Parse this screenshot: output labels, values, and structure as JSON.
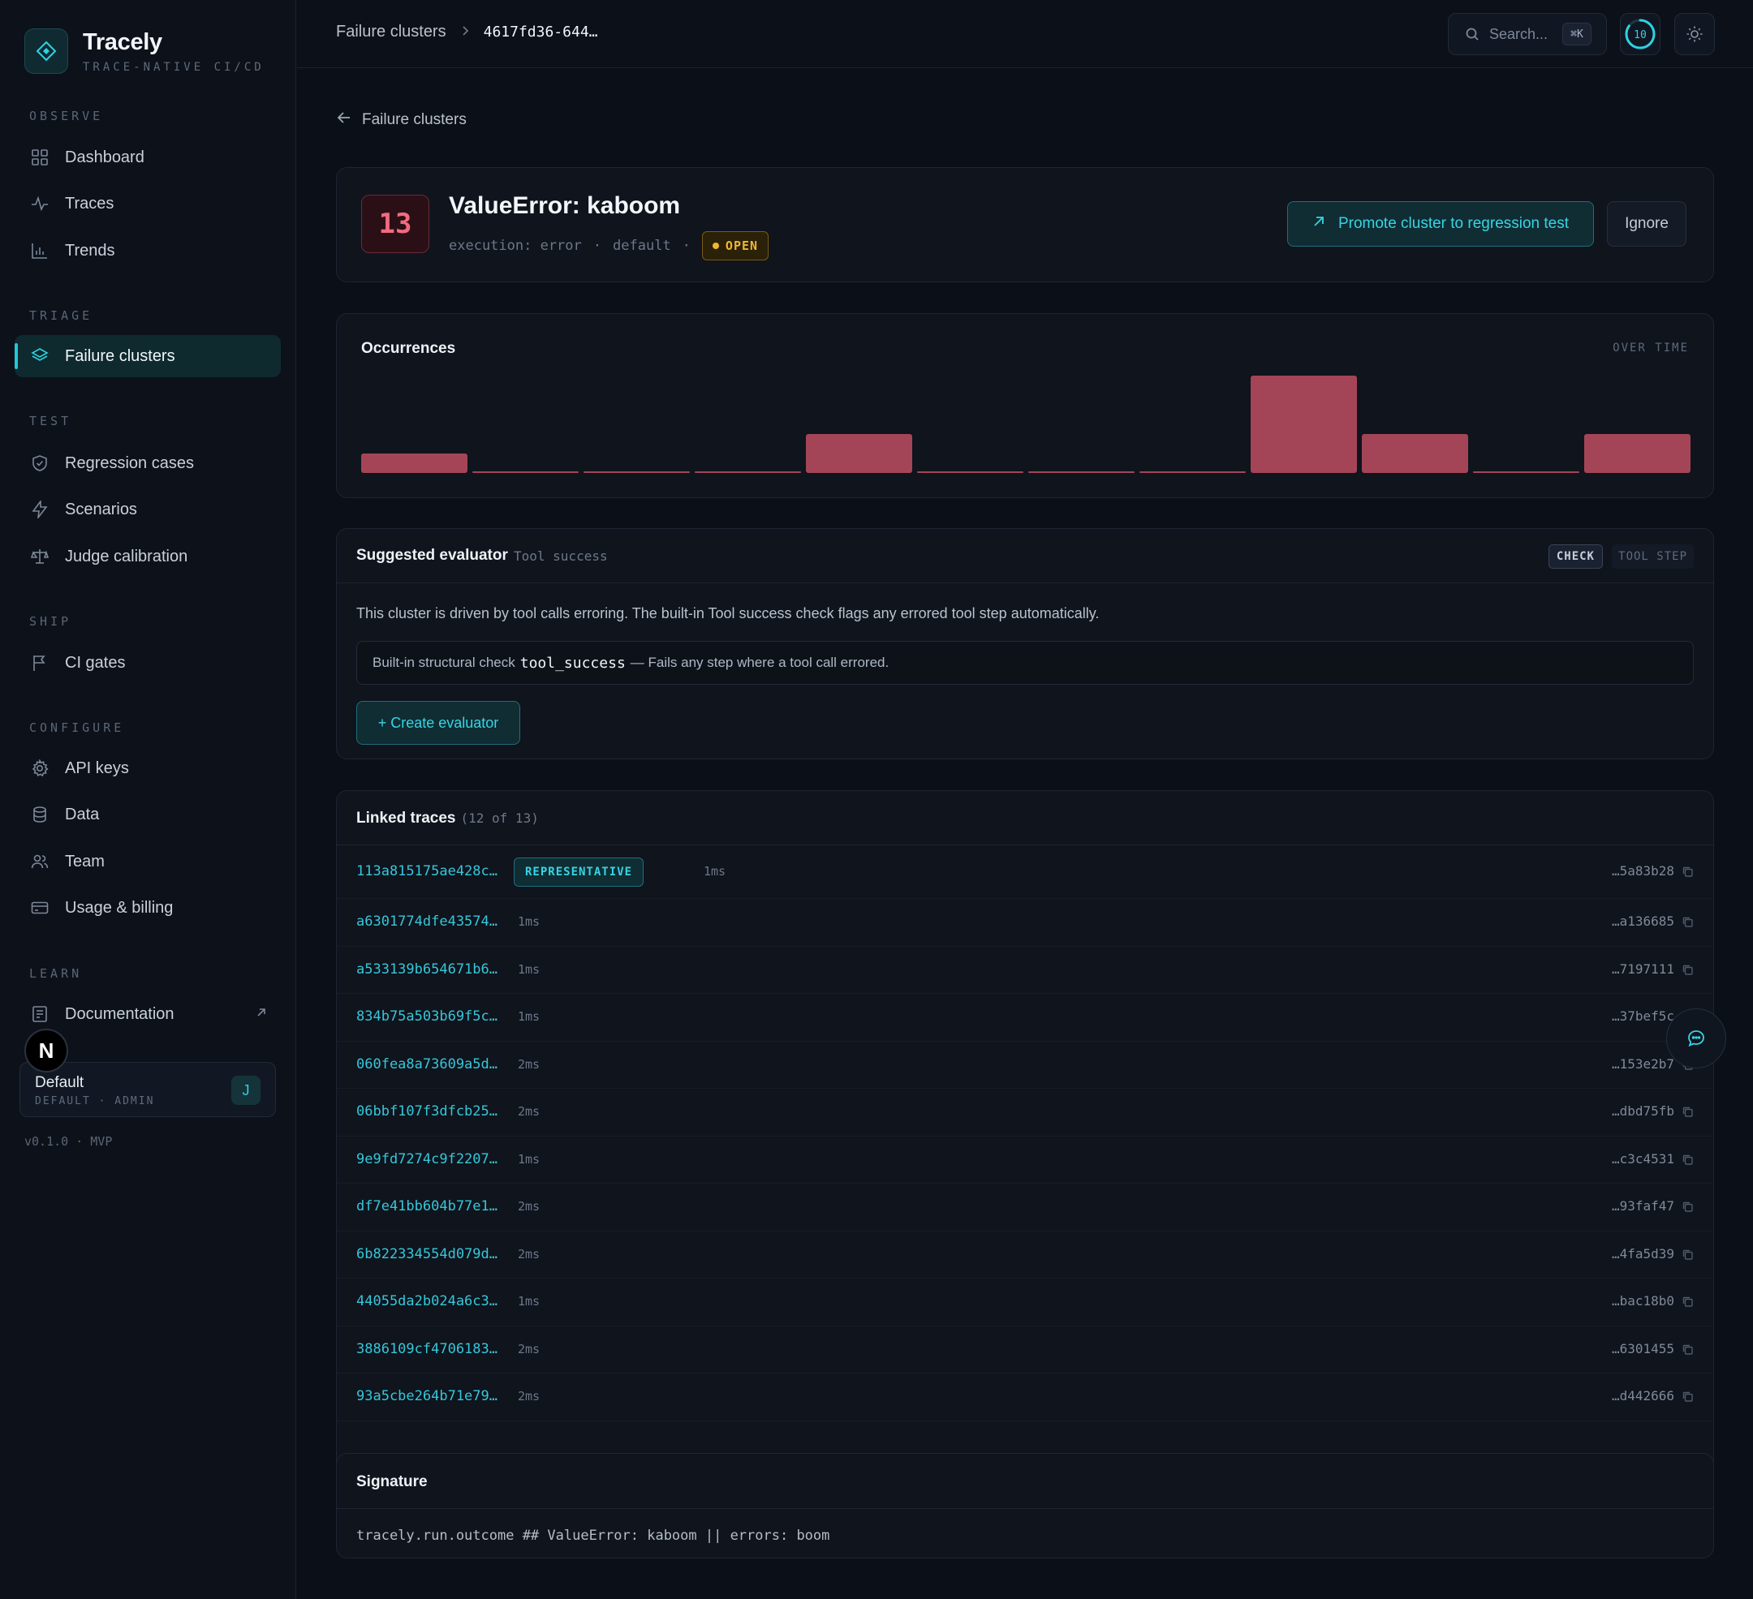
{
  "brand": {
    "name": "Tracely",
    "tagline": "TRACE-NATIVE CI/CD"
  },
  "sidebar": {
    "sections": {
      "observe": "OBSERVE",
      "triage": "TRIAGE",
      "test": "TEST",
      "ship": "SHIP",
      "configure": "CONFIGURE",
      "learn": "LEARN"
    },
    "items": {
      "dashboard": "Dashboard",
      "traces": "Traces",
      "trends": "Trends",
      "failure_clusters": "Failure clusters",
      "regression_cases": "Regression cases",
      "scenarios": "Scenarios",
      "judge_calibration": "Judge calibration",
      "ci_gates": "CI gates",
      "api_keys": "API keys",
      "data": "Data",
      "team": "Team",
      "usage_billing": "Usage & billing",
      "documentation": "Documentation"
    },
    "active_item": "failure_clusters",
    "avatar_letter": "N",
    "org": {
      "name": "Default",
      "role": "DEFAULT · ADMIN",
      "badge": "J"
    },
    "version": "v0.1.0 · MVP"
  },
  "topbar": {
    "breadcrumb_parent": "Failure clusters",
    "breadcrumb_current": "4617fd36-644…",
    "search_placeholder": "Search...",
    "search_shortcut": "⌘K",
    "progress_value": "10",
    "progress_fraction": 0.85
  },
  "back_link": "Failure clusters",
  "cluster": {
    "count": "13",
    "title": "ValueError: kaboom",
    "meta_1": "execution: error",
    "meta_2": "default",
    "status": "OPEN",
    "promote_label": "Promote cluster to regression test",
    "ignore_label": "Ignore"
  },
  "occurrences": {
    "title": "Occurrences",
    "label": "OVER TIME"
  },
  "chart_data": {
    "type": "bar",
    "values": [
      2,
      0,
      0,
      0,
      4,
      0,
      0,
      0,
      10,
      4,
      0,
      4
    ],
    "ylim": [
      0,
      10
    ],
    "color": "#a44557"
  },
  "evaluator": {
    "title": "Suggested evaluator",
    "subtitle": "Tool success",
    "tag_check": "CHECK",
    "tag_tool": "TOOL STEP",
    "description": "This cluster is driven by tool calls erroring. The built-in Tool success check flags any errored tool step automatically.",
    "box_prefix": "Built-in structural check",
    "box_code": "tool_success",
    "box_suffix": "— Fails any step where a tool call errored.",
    "create_label": "+ Create evaluator"
  },
  "linked_traces": {
    "title": "Linked traces",
    "count": "(12 of 13)",
    "representative_label": "REPRESENTATIVE",
    "rows": [
      {
        "id": "113a815175ae428c…",
        "dur": "1ms",
        "span": "…5a83b28",
        "rep": true
      },
      {
        "id": "a6301774dfe43574…",
        "dur": "1ms",
        "span": "…a136685"
      },
      {
        "id": "a533139b654671b6…",
        "dur": "1ms",
        "span": "…7197111"
      },
      {
        "id": "834b75a503b69f5c…",
        "dur": "1ms",
        "span": "…37bef5c"
      },
      {
        "id": "060fea8a73609a5d…",
        "dur": "2ms",
        "span": "…153e2b7"
      },
      {
        "id": "06bbf107f3dfcb25…",
        "dur": "2ms",
        "span": "…dbd75fb"
      },
      {
        "id": "9e9fd7274c9f2207…",
        "dur": "1ms",
        "span": "…c3c4531"
      },
      {
        "id": "df7e41bb604b77e1…",
        "dur": "2ms",
        "span": "…93faf47"
      },
      {
        "id": "6b822334554d079d…",
        "dur": "2ms",
        "span": "…4fa5d39"
      },
      {
        "id": "44055da2b024a6c3…",
        "dur": "1ms",
        "span": "…bac18b0"
      },
      {
        "id": "3886109cf4706183…",
        "dur": "2ms",
        "span": "…6301455"
      },
      {
        "id": "93a5cbe264b71e79…",
        "dur": "2ms",
        "span": "…d442666"
      }
    ]
  },
  "signature": {
    "title": "Signature",
    "text": "tracely.run.outcome ## ValueError: kaboom || errors: boom"
  }
}
